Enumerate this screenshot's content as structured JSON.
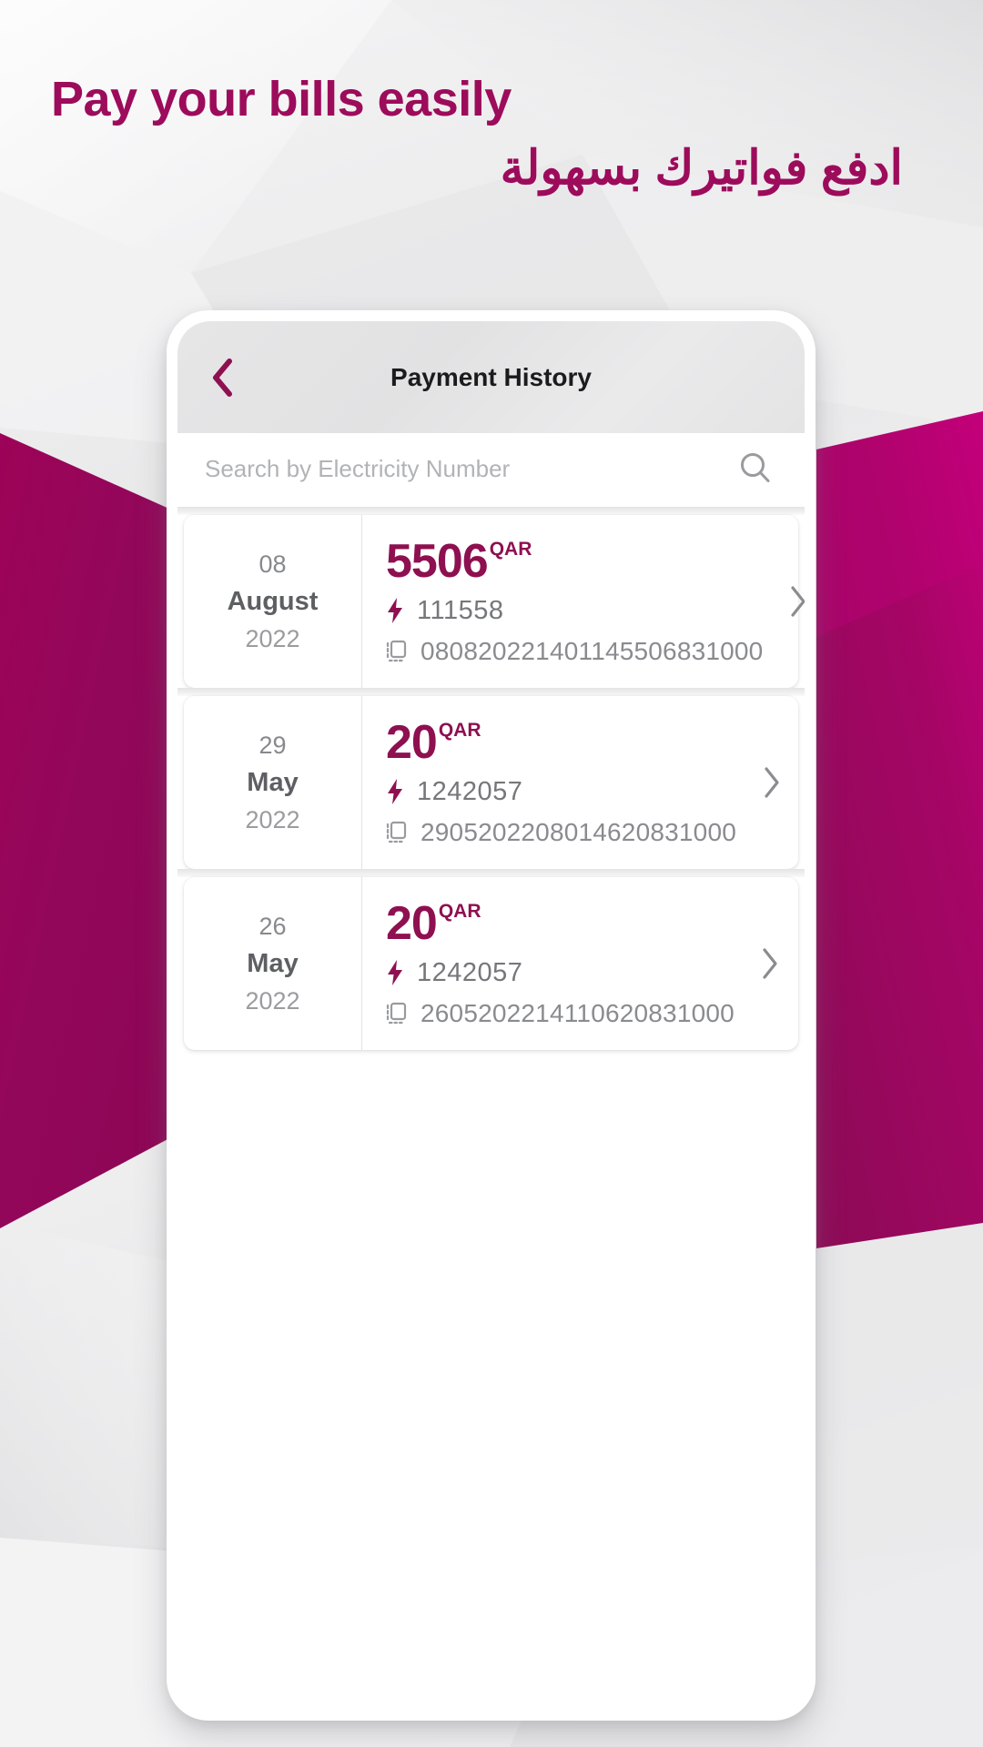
{
  "hero": {
    "headline_en": "Pay your bills easily",
    "headline_ar": "ادفع فواتيرك بسهولة",
    "accent_color": "#9d0b5b"
  },
  "app": {
    "appbar": {
      "title": "Payment History",
      "back_icon": "chevron-left-icon",
      "back_icon_color": "#8e1050"
    },
    "search": {
      "placeholder": "Search by Electricity Number",
      "value": "",
      "icon": "search-icon"
    },
    "currency": "QAR",
    "icons": {
      "electricity": "lightning-bolt-icon",
      "reference": "receipt-icon",
      "row_arrow": "chevron-right-icon"
    },
    "transactions": [
      {
        "day": "08",
        "month": "August",
        "year": "2022",
        "amount": "5506",
        "currency": "QAR",
        "electricity_number": "111558",
        "reference": "080820221401145506831000"
      },
      {
        "day": "29",
        "month": "May",
        "year": "2022",
        "amount": "20",
        "currency": "QAR",
        "electricity_number": "1242057",
        "reference": "2905202208014620831000"
      },
      {
        "day": "26",
        "month": "May",
        "year": "2022",
        "amount": "20",
        "currency": "QAR",
        "electricity_number": "1242057",
        "reference": "2605202214110620831000"
      }
    ]
  },
  "colors": {
    "magenta_dark": "#8e1050",
    "magenta_bright": "#b1036b",
    "magenta_brand": "#9d0b5b",
    "text_dark": "#1b1b1d",
    "text_grey": "#76777b"
  }
}
